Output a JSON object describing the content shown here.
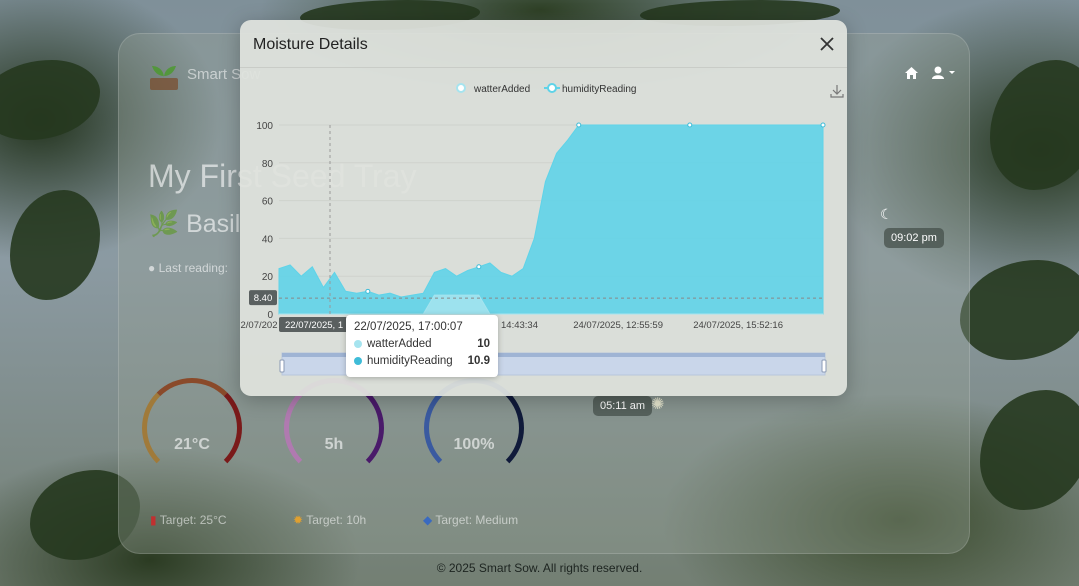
{
  "app": {
    "brand": "Smart Sow",
    "tray_title": "My First Seed Tray",
    "plant": "Basil",
    "last_reading_label": "Last reading:",
    "footer": "© 2025 Smart Sow. All rights reserved."
  },
  "gauges": [
    {
      "value": "21°C",
      "ticks": [
        "0",
        "10",
        "20",
        "30",
        "40"
      ],
      "target": "Target: 25°C",
      "color": "#8a2a1a"
    },
    {
      "value": "5h",
      "ticks": [
        "0",
        "2.5",
        "10"
      ],
      "target": "Target: 10h",
      "color": "#5a2a7a"
    },
    {
      "value": "100%",
      "ticks": [
        "0",
        "25",
        "100"
      ],
      "target": "Target: Medium",
      "color": "#1e3a7a"
    }
  ],
  "sun": {
    "sunset": "09:02 pm",
    "sunrise": "05:11 am"
  },
  "modal": {
    "title": "Moisture Details"
  },
  "tooltip": {
    "time": "22/07/2025, 17:00:07",
    "rows": [
      {
        "name": "watterAdded",
        "value": "10",
        "color": "#a6e4ef"
      },
      {
        "name": "humidityReading",
        "value": "10.9",
        "color": "#3fbcd8"
      }
    ]
  },
  "chart_data": {
    "type": "area",
    "legend": [
      "watterAdded",
      "humidityReading"
    ],
    "legend_position": "top",
    "ylim": [
      0,
      100
    ],
    "y_ticks": [
      0,
      20,
      40,
      60,
      80,
      100
    ],
    "x_tick_labels": [
      "2/07/202",
      "22/07/2025, 1",
      "24/07/2025, 14:43:34",
      "24/07/2025, 12:55:59",
      "24/07/2025, 15:52:16"
    ],
    "y_pointer_label": "8.40",
    "grid": true,
    "series": [
      {
        "name": "humidityReading",
        "color": "#5fd3e8",
        "values": [
          24,
          26,
          20,
          25,
          14,
          22,
          12,
          11,
          12,
          10,
          11,
          9,
          10,
          11,
          22,
          24,
          20,
          23,
          25,
          27,
          22,
          20,
          24,
          40,
          70,
          85,
          92,
          100,
          100,
          100,
          100,
          100,
          100,
          100,
          100,
          100,
          100,
          100,
          100,
          100,
          100,
          100,
          100,
          100,
          100,
          100,
          100,
          100,
          100,
          100
        ]
      },
      {
        "name": "watterAdded",
        "color": "#a6e4ef",
        "values": [
          0,
          0,
          0,
          0,
          0,
          0,
          0,
          0,
          0,
          0,
          0,
          0,
          0,
          0,
          10,
          10,
          10,
          10,
          10,
          0,
          0,
          0,
          0,
          0,
          0,
          0,
          0,
          0,
          0,
          0,
          0,
          0,
          0,
          0,
          0,
          0,
          0,
          0,
          0,
          0,
          0,
          0,
          0,
          0,
          0,
          0,
          0,
          0,
          0,
          0
        ]
      }
    ]
  }
}
